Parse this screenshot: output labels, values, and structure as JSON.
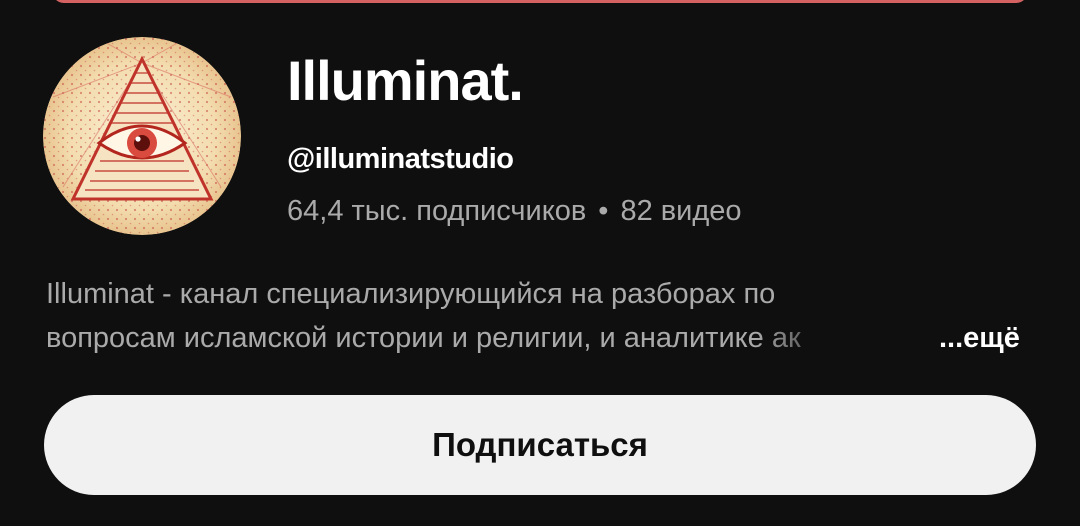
{
  "channel": {
    "title": "Illuminat.",
    "handle": "@illuminatstudio",
    "subscribers": "64,4 тыс. подписчиков",
    "separator": "•",
    "videos": "82 видео",
    "avatar_icon": "all-seeing-eye-pyramid-icon"
  },
  "description": {
    "line1": "Illuminat - канал специализирующийся на разборах по",
    "line2": "вопросам исламской истории и религии, и аналитике ак",
    "more_label": "...ещё"
  },
  "actions": {
    "subscribe_label": "Подписаться"
  },
  "colors": {
    "background": "#0f0f0f",
    "button_bg": "#f1f1f1",
    "secondary_text": "#aaaaaa",
    "banner": "#d46262"
  }
}
